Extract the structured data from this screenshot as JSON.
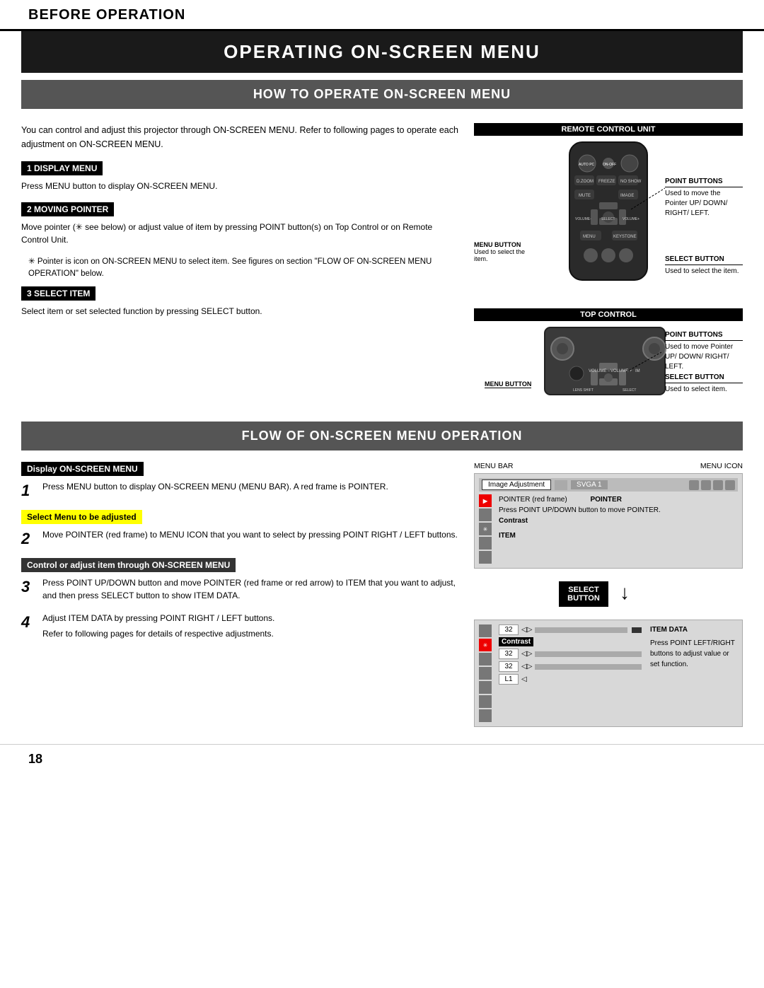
{
  "page": {
    "number": "18",
    "top_section": "BEFORE OPERATION",
    "main_title": "OPERATING ON-SCREEN MENU",
    "sub_title": "HOW TO OPERATE ON-SCREEN MENU",
    "flow_title": "FLOW OF ON-SCREEN MENU OPERATION"
  },
  "intro": {
    "text": "You can control and adjust this projector through ON-SCREEN MENU. Refer to following pages to operate each adjustment on ON-SCREEN MENU."
  },
  "steps": {
    "step1": {
      "label": "1  DISPLAY MENU",
      "text": "Press MENU button to display ON-SCREEN MENU."
    },
    "step2": {
      "label": "2  MOVING POINTER",
      "text": "Move pointer (✳ see below) or adjust value of item by pressing POINT button(s) on Top Control or on Remote Control Unit."
    },
    "asterisk": {
      "text": "✳  Pointer is icon on ON-SCREEN MENU to select item.  See figures on section \"FLOW OF ON-SCREEN MENU OPERATION\" below."
    },
    "step3": {
      "label": "3  SELECT ITEM",
      "text": "Select item or set selected function by pressing SELECT button."
    }
  },
  "remote_unit": {
    "label": "REMOTE CONTROL UNIT",
    "point_buttons_label": "POINT BUTTONS",
    "point_buttons_desc": "Used to move the Pointer UP/ DOWN/ RIGHT/ LEFT.",
    "menu_button_label": "MENU BUTTON",
    "menu_button_desc": "Used to select the item.",
    "select_button_label": "SELECT BUTTON",
    "select_button_desc": "Used to select the item."
  },
  "top_control": {
    "label": "TOP CONTROL",
    "menu_button_label": "MENU BUTTON",
    "point_buttons_label": "POINT BUTTONS",
    "point_buttons_desc": "Used to move Pointer UP/ DOWN/ RIGHT/ LEFT.",
    "select_button_label": "SELECT BUTTON",
    "select_button_desc": "Used to select item."
  },
  "flow": {
    "step1": {
      "label": "Display ON-SCREEN MENU",
      "number": "1",
      "text": "Press MENU button to display ON-SCREEN MENU (MENU BAR). A red frame is POINTER."
    },
    "step2": {
      "label": "Select Menu to be adjusted",
      "number": "2",
      "text": "Move POINTER (red frame) to MENU ICON that you want to select by pressing POINT RIGHT / LEFT buttons."
    },
    "step3": {
      "label": "Control or adjust item through ON-SCREEN MENU",
      "number": "3",
      "text": "Press POINT UP/DOWN button and move POINTER (red frame or red arrow) to ITEM that you want to adjust, and then press SELECT button to show ITEM DATA."
    },
    "step4": {
      "number": "4",
      "text1": "Adjust ITEM DATA by pressing POINT RIGHT / LEFT buttons.",
      "text2": "Refer to following pages for details of respective adjustments."
    }
  },
  "diagram": {
    "menu_bar_label": "MENU BAR",
    "menu_icon_label": "MENU ICON",
    "pointer_label": "POINTER (red frame)",
    "pointer_label2": "POINTER",
    "pointer_sub": "(red frame)",
    "press_label": "Press POINT UP/DOWN button to move POINTER.",
    "item_label": "ITEM",
    "item_data_label": "ITEM DATA",
    "item_data_desc": "Press POINT LEFT/RIGHT buttons to adjust value or set function.",
    "select_button_label": "SELECT\nBUTTON",
    "menu_bar_tabs": [
      "Image Adjustment",
      "SVGA 1"
    ],
    "contrast_label": "Contrast",
    "values": [
      "32",
      "32",
      "32",
      "L1"
    ]
  }
}
